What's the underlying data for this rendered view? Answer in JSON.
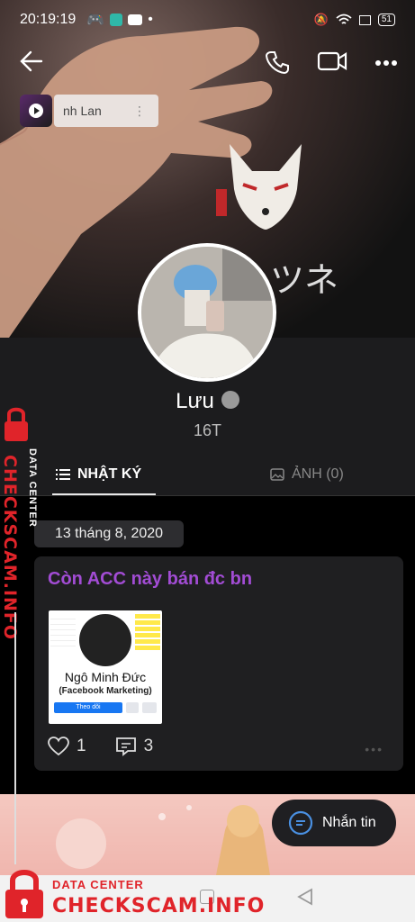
{
  "status_bar": {
    "time": "20:19:19",
    "battery": "51"
  },
  "mini_player": {
    "label": "nh Lan",
    "menu": "⋮"
  },
  "cover_text": "ツネ",
  "profile": {
    "name": "Lưu",
    "subtitle": "16T"
  },
  "tabs": [
    {
      "label": "NHẬT KÝ",
      "active": true
    },
    {
      "label": "ẢNH (0)",
      "active": false
    }
  ],
  "diary": {
    "date": "13 tháng 8, 2020",
    "post": {
      "title": "Còn ACC này bán đc bn",
      "image": {
        "name": "Ngô Minh Đức",
        "role": "(Facebook Marketing)",
        "follow": "Theo dõi"
      },
      "likes": "1",
      "comments": "3"
    }
  },
  "message_button": "Nhắn tin",
  "watermark": {
    "line1": "DATA CENTER",
    "line2": "CHECKSCAM.INFO"
  },
  "colors": {
    "post_title": "#a24cd4",
    "watermark": "#e0242a"
  }
}
